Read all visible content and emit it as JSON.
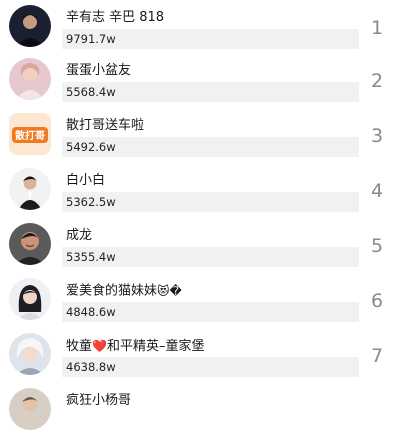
{
  "rankings": [
    {
      "name": "辛有志 辛巴 818",
      "count": "9791.7w",
      "rank": "1",
      "avatar_icon": "avatar-man-dark-icon"
    },
    {
      "name": "蛋蛋小盆友",
      "count": "5568.4w",
      "rank": "2",
      "avatar_icon": "avatar-woman-pink-icon"
    },
    {
      "name": "散打哥送车啦",
      "count": "5492.6w",
      "rank": "3",
      "avatar_icon": "avatar-logo-orange-icon",
      "avatar_text": "散打哥"
    },
    {
      "name": "白小白",
      "count": "5362.5w",
      "rank": "4",
      "avatar_icon": "avatar-man-suit-icon"
    },
    {
      "name": "成龙",
      "count": "5355.4w",
      "rank": "5",
      "avatar_icon": "avatar-man-smile-icon"
    },
    {
      "name": "爱美食的猫妹妹",
      "name_suffix": "😻�",
      "count": "4848.6w",
      "rank": "6",
      "avatar_icon": "avatar-girl-icon"
    },
    {
      "name_prefix": "牧童",
      "name_heart": "❤️",
      "name": "和平精英–童家堡",
      "count": "4638.8w",
      "rank": "7",
      "avatar_icon": "avatar-cartoon-white-hair-icon"
    },
    {
      "name": "疯狂小杨哥",
      "count": "",
      "rank": "",
      "avatar_icon": "avatar-man-light-icon"
    }
  ]
}
